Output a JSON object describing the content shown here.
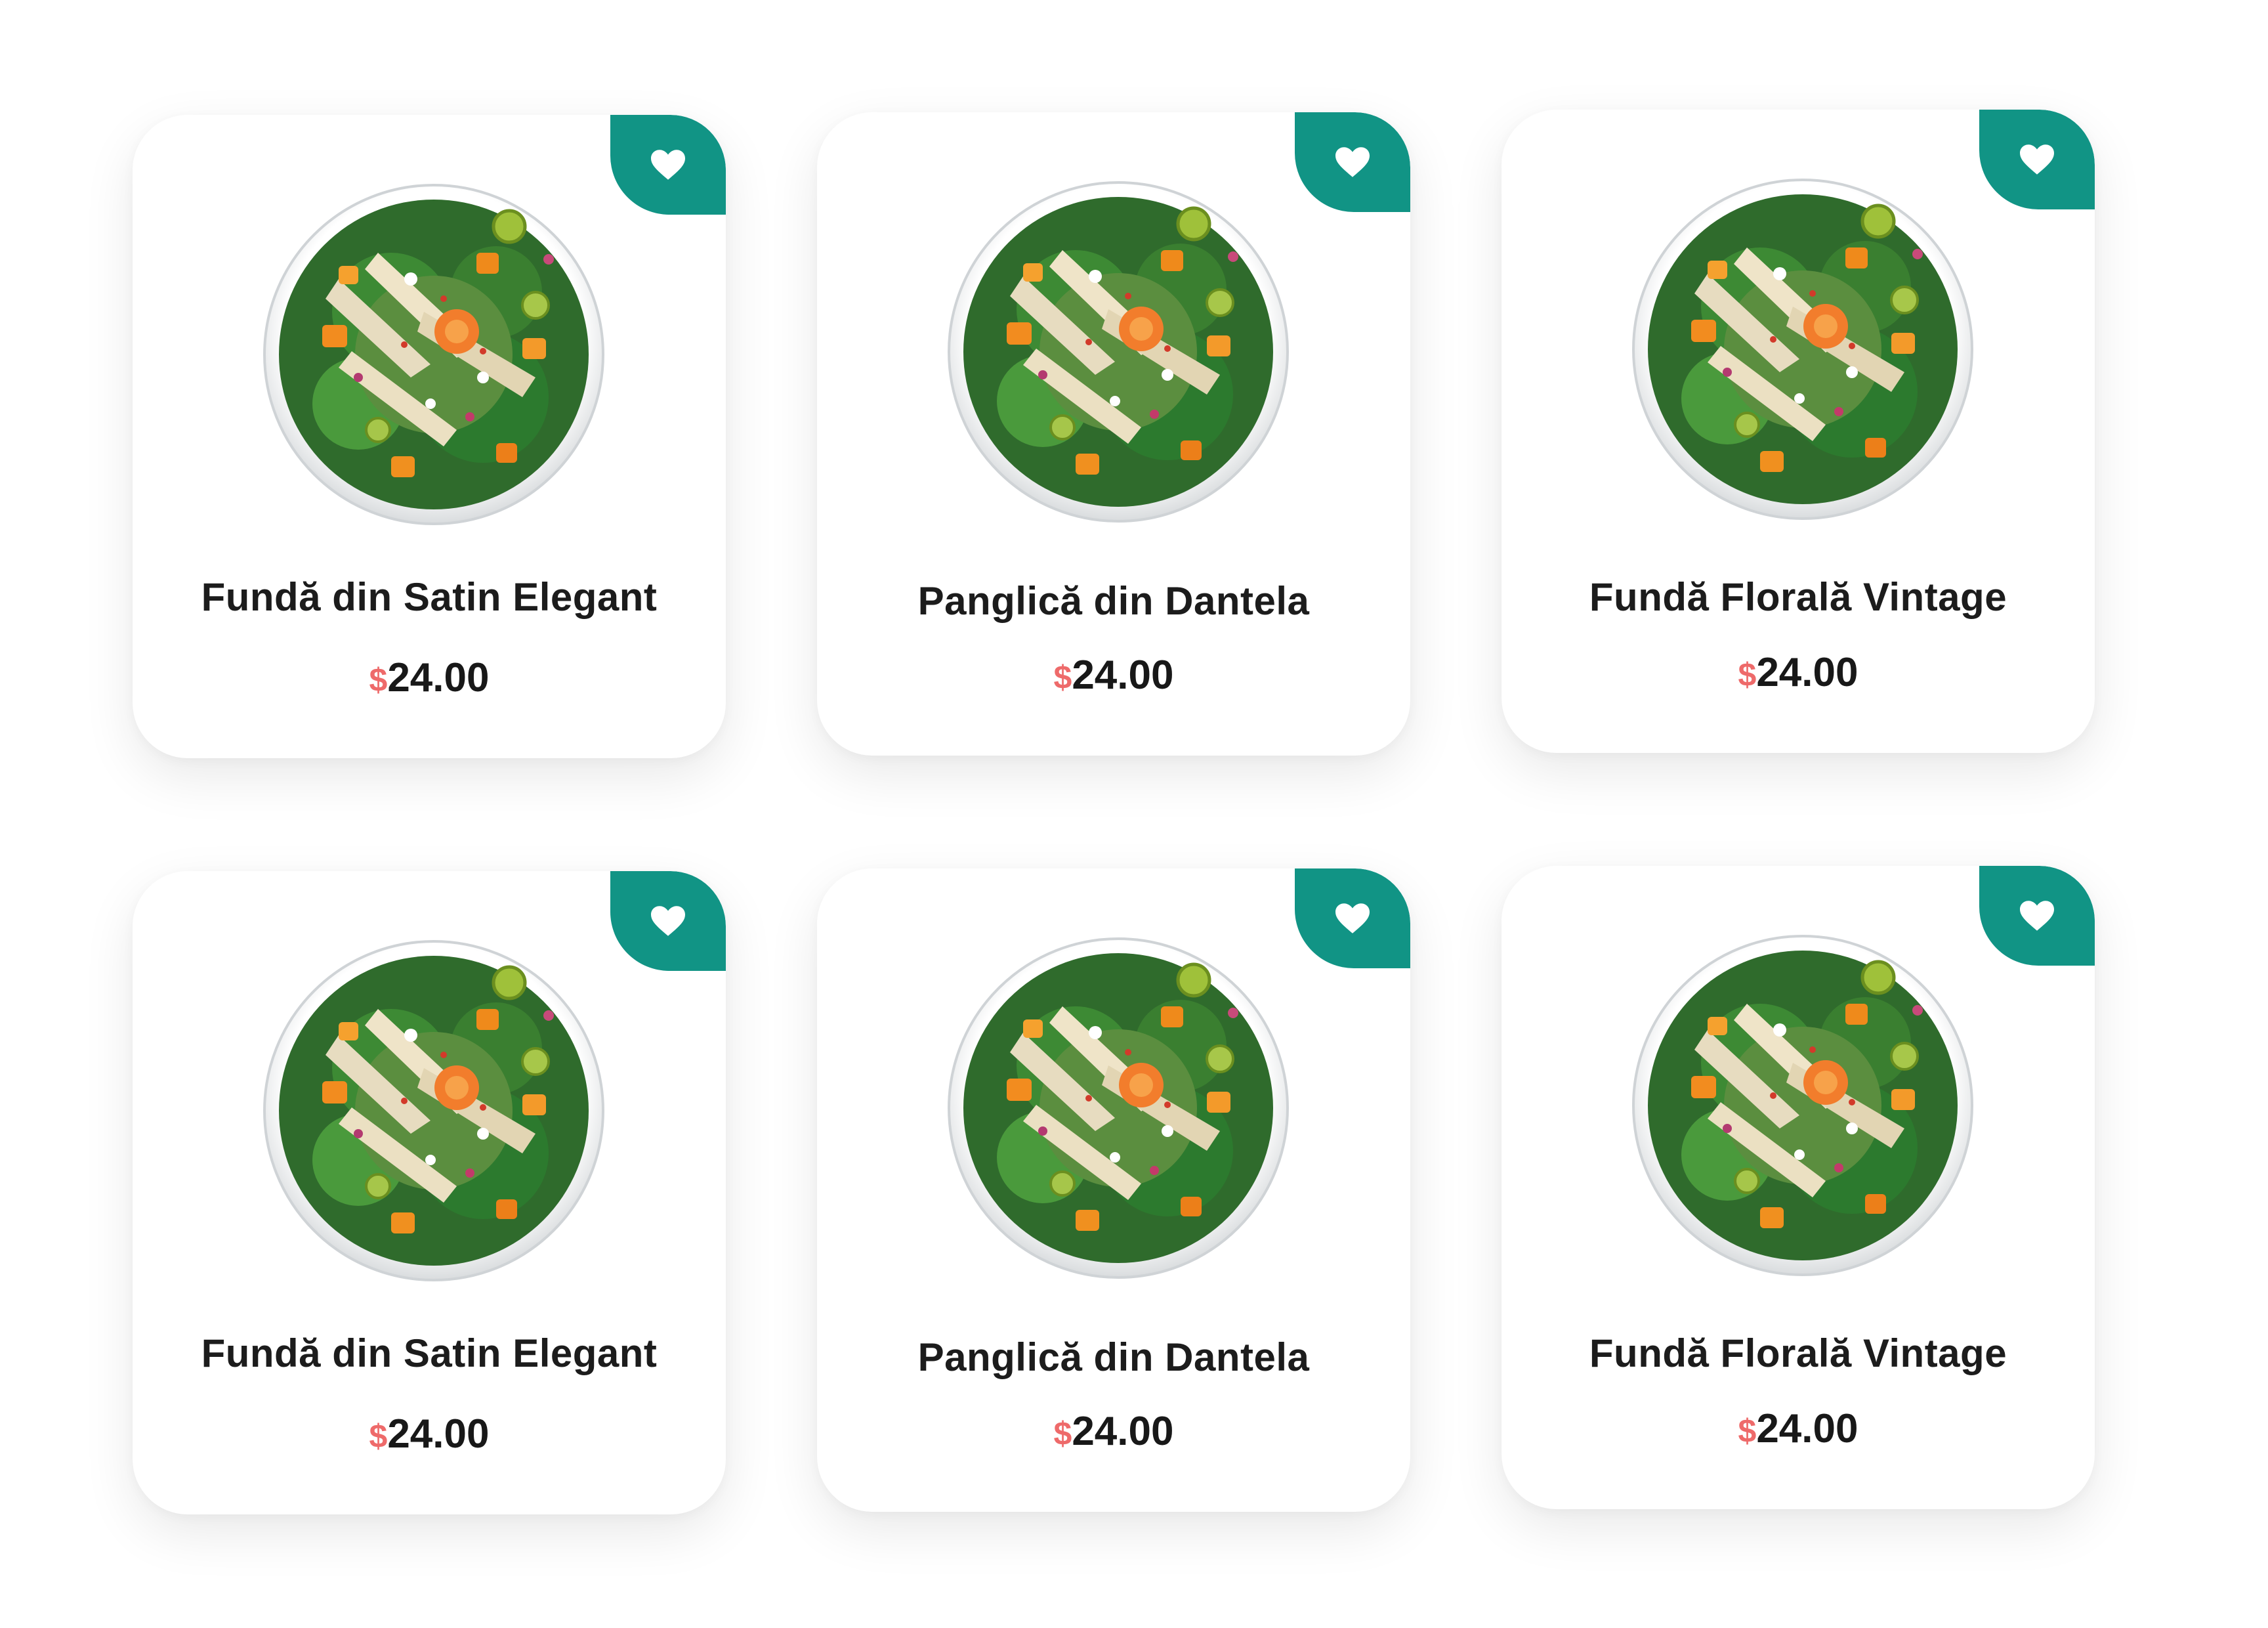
{
  "colors": {
    "accent": "#119485",
    "currency": "#ee6a6a",
    "card_bg": "#ffffff"
  },
  "icons": {
    "favorite": "heart-icon",
    "product_image": "salad-bowl-image"
  },
  "products": [
    {
      "name": "Fundă din Satin Elegant",
      "currency": "$",
      "price": "24.00"
    },
    {
      "name": "Panglică din Dantela",
      "currency": "$",
      "price": "24.00"
    },
    {
      "name": "Fundă Florală Vintage",
      "currency": "$",
      "price": "24.00"
    },
    {
      "name": "Fundă din Satin Elegant",
      "currency": "$",
      "price": "24.00"
    },
    {
      "name": "Panglică din Dantela",
      "currency": "$",
      "price": "24.00"
    },
    {
      "name": "Fundă Florală Vintage",
      "currency": "$",
      "price": "24.00"
    }
  ]
}
